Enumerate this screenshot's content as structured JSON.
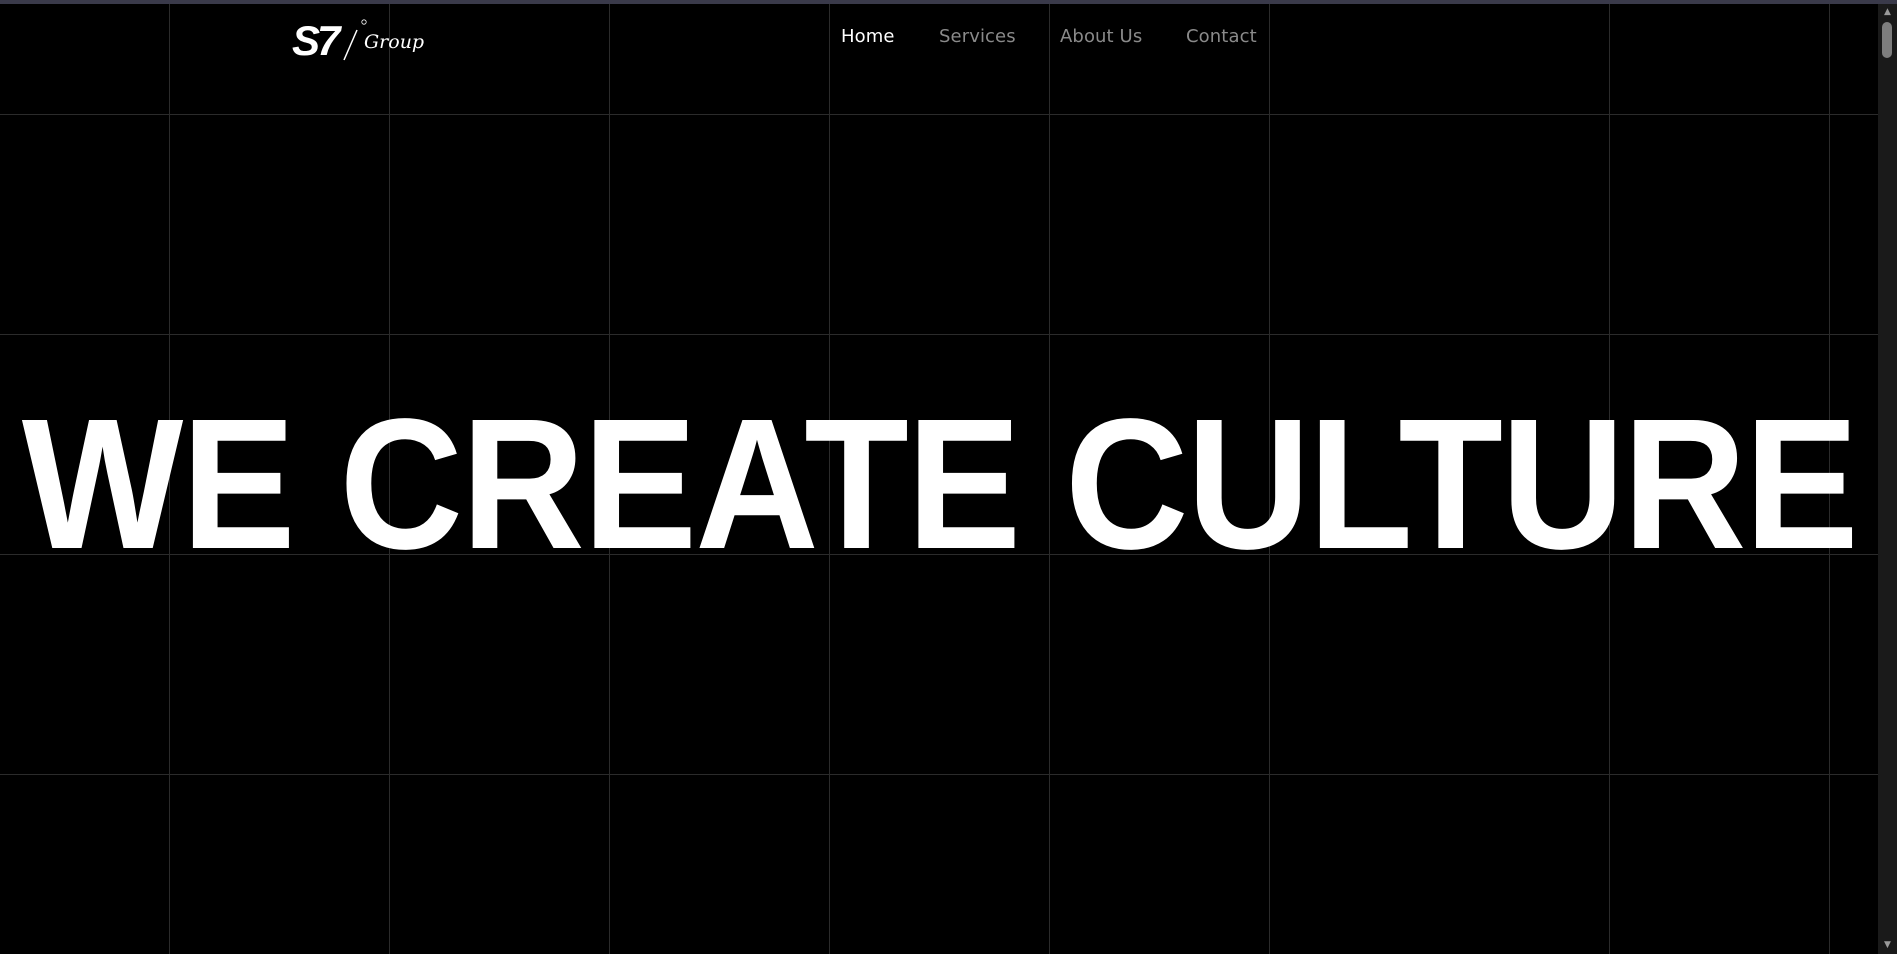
{
  "brand": {
    "logo_text": "S7",
    "logo_script": "Group"
  },
  "nav": {
    "items": [
      {
        "label": "Home",
        "active": true
      },
      {
        "label": "Services",
        "active": false
      },
      {
        "label": "About Us",
        "active": false
      },
      {
        "label": "Contact",
        "active": false
      }
    ]
  },
  "hero": {
    "title": "WE CREATE CULTURE"
  },
  "colors": {
    "background": "#000000",
    "text": "#ffffff",
    "nav_inactive": "#8a8a8a",
    "grid_line": "#2b2b2b"
  },
  "icons": {
    "scroll_up": "triangle-up",
    "scroll_down": "triangle-down"
  }
}
